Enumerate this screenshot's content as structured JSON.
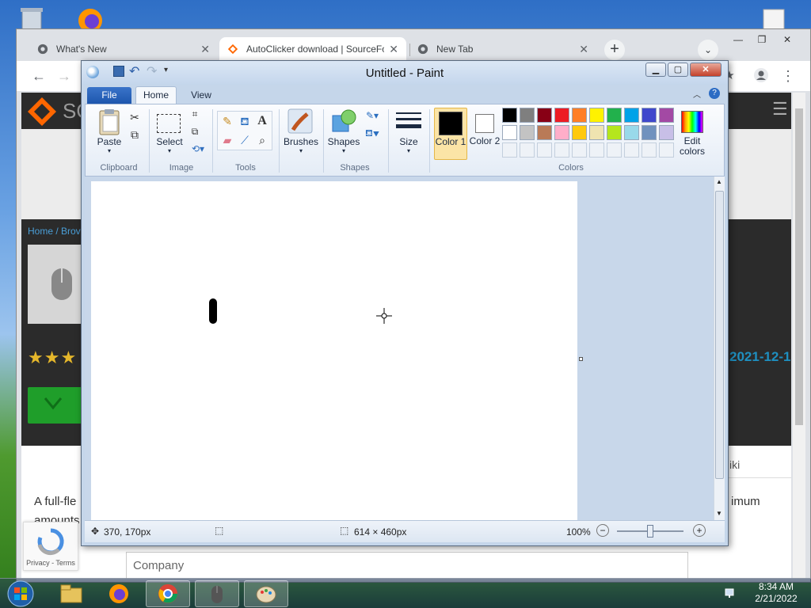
{
  "chrome": {
    "tabs": [
      {
        "title": "What's New",
        "close": "✕"
      },
      {
        "title": "AutoClicker download | SourceFo",
        "close": "✕"
      },
      {
        "title": "New Tab",
        "close": "✕"
      }
    ],
    "new_tab": "+",
    "window_controls": {
      "minimize": "—",
      "restore": "❐",
      "close": "✕"
    }
  },
  "website": {
    "logo_text": "SO",
    "breadcrumb": "Home / Brov",
    "rating_stars": "★★★",
    "date_partial": "2021-12-1",
    "wiki_partial": "iki",
    "desc_line1": "A full-fle",
    "desc_line1_end": "imum",
    "desc_line2": "amounts",
    "company_placeholder": "Company",
    "recaptcha_text": "Privacy - Terms"
  },
  "paint": {
    "title": "Untitled - Paint",
    "tabs": {
      "file": "File",
      "home": "Home",
      "view": "View"
    },
    "groups": {
      "clipboard": "Clipboard",
      "image": "Image",
      "tools": "Tools",
      "shapes": "Shapes",
      "colors": "Colors"
    },
    "buttons": {
      "paste": "Paste",
      "select": "Select",
      "brushes": "Brushes",
      "shapes": "Shapes",
      "size": "Size",
      "color1": "Color 1",
      "color2": "Color 2",
      "edit_colors": "Edit colors"
    },
    "color1_value": "#000000",
    "color2_value": "#ffffff",
    "palette_row1": [
      "#000000",
      "#7f7f7f",
      "#880015",
      "#ed1c24",
      "#ff7f27",
      "#fff200",
      "#22b14c",
      "#00a2e8",
      "#3f48cc",
      "#a349a4"
    ],
    "palette_row2": [
      "#ffffff",
      "#c3c3c3",
      "#b97a57",
      "#ffaec9",
      "#ffc90e",
      "#efe4b0",
      "#b5e61d",
      "#99d9ea",
      "#7092be",
      "#c8bfe7"
    ],
    "status": {
      "cursor_pos": "370, 170px",
      "canvas_size": "614 × 460px",
      "zoom": "100%"
    }
  },
  "taskbar": {
    "time": "8:34 AM",
    "date": "2/21/2022"
  }
}
